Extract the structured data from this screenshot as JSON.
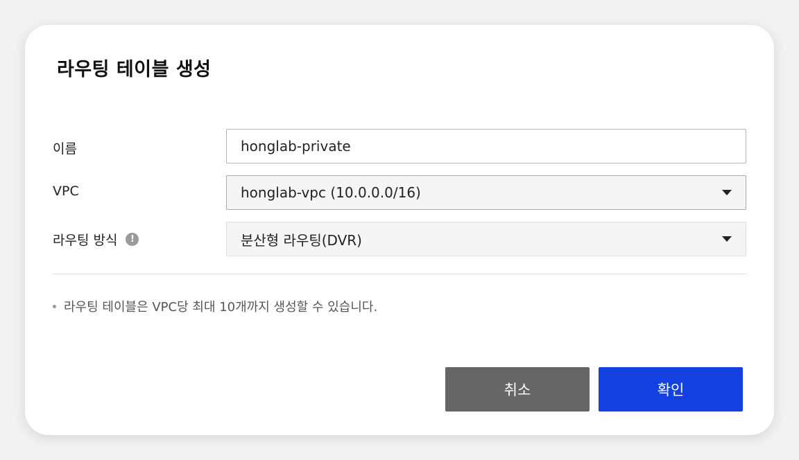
{
  "dialog": {
    "title": "라우팅 테이블 생성",
    "name_label": "이름",
    "name_value": "honglab-private",
    "vpc_label": "VPC",
    "vpc_value": "honglab-vpc (10.0.0.0/16)",
    "routing_mode_label": "라우팅 방식",
    "routing_mode_value": "분산형 라우팅(DVR)",
    "note": "라우팅 테이블은 VPC당 최대 10개까지 생성할 수 있습니다.",
    "cancel_label": "취소",
    "confirm_label": "확인"
  },
  "icons": {
    "info": "info-icon",
    "dropdown": "chevron-down-icon"
  },
  "colors": {
    "confirm_button": "#1340e0",
    "cancel_button": "#666666"
  }
}
